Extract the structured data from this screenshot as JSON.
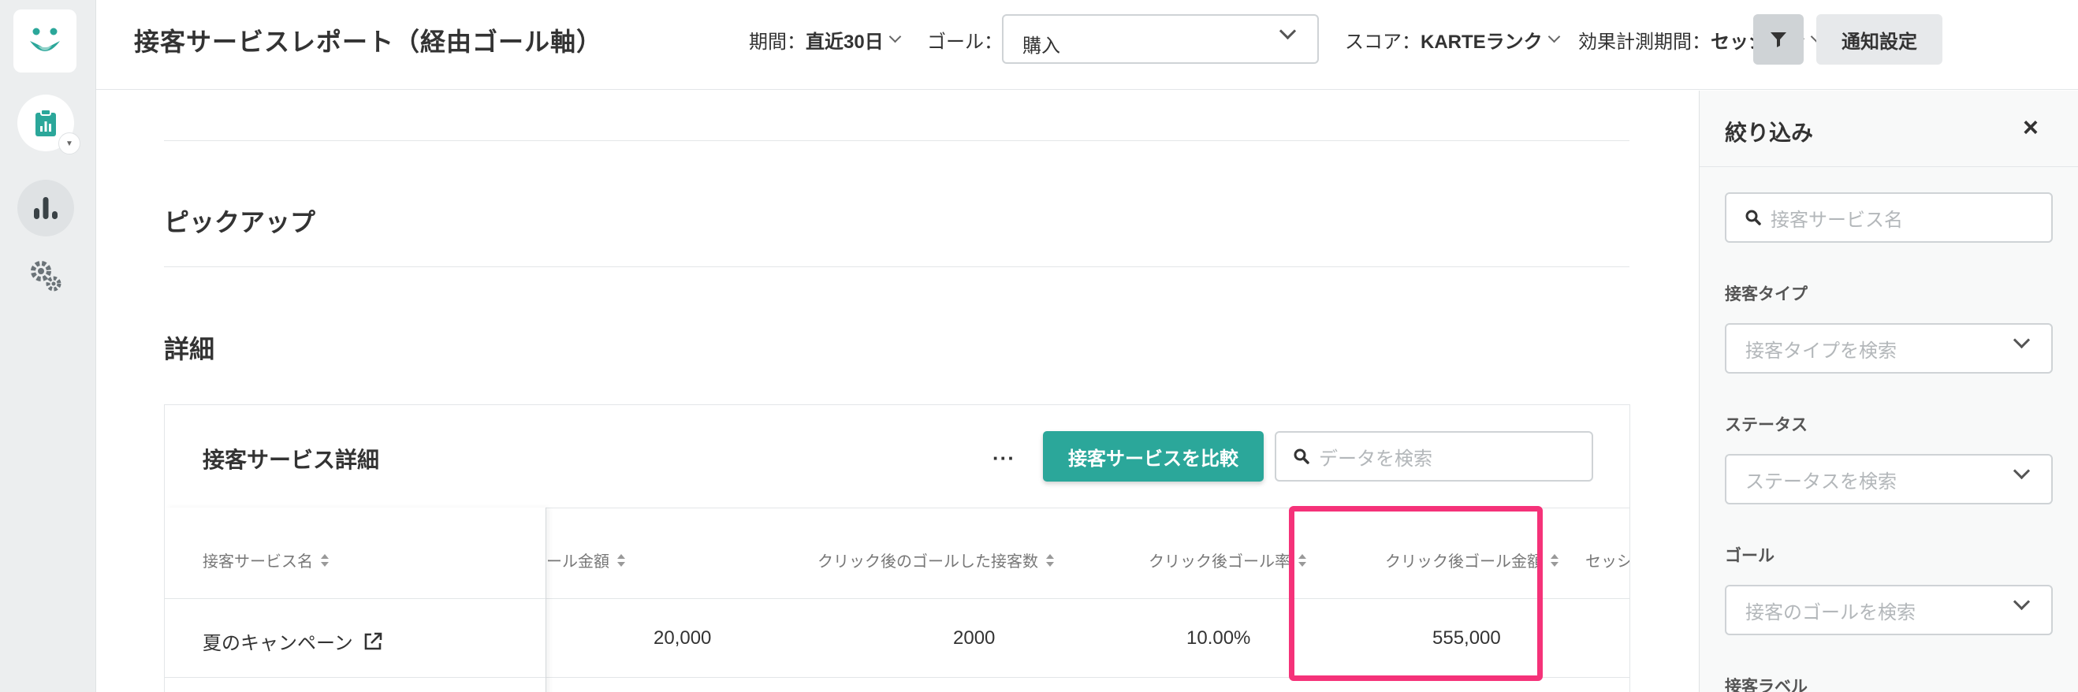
{
  "header": {
    "title": "接客サービスレポート（経由ゴール軸）",
    "period_label": "期間：",
    "period_value": "直近30日",
    "goal_label": "ゴール：",
    "goal_value": "購入",
    "score_label": "スコア：",
    "score_value": "KARTEランク",
    "measure_label": "効果計測期間：",
    "measure_value": "セッション",
    "notify_label": "通知設定"
  },
  "main": {
    "pickup_title": "ピックアップ",
    "detail_title": "詳細",
    "card": {
      "title": "接客サービス詳細",
      "more_label": "···",
      "compare_label": "接客サービスを比較",
      "search_placeholder": "データを検索",
      "columns": [
        "接客サービス名",
        "ゴール金額",
        "クリック後のゴールした接客数",
        "クリック後ゴール率",
        "クリック後ゴール金額",
        "セッシ"
      ],
      "rows": [
        {
          "name": "夏のキャンペーン",
          "goal_amount": "20,000",
          "click_goal_count": "2000",
          "click_goal_rate": "10.00%",
          "click_goal_amount": "555,000"
        }
      ]
    }
  },
  "panel": {
    "title": "絞り込み",
    "close_label": "×",
    "name_placeholder": "接客サービス名",
    "type_label": "接客タイプ",
    "type_placeholder": "接客タイプを検索",
    "status_label": "ステータス",
    "status_placeholder": "ステータスを検索",
    "goal_label": "ゴール",
    "goal_placeholder": "接客のゴールを検索",
    "tag_label": "接客ラベル"
  },
  "colors": {
    "accent": "#2ba79a",
    "highlight": "#f53279",
    "rail": "#eceeef"
  },
  "icons": [
    "karte-logo-icon",
    "report-clipboard-icon",
    "analytics-bars-icon",
    "settings-gears-icon",
    "filter-funnel-icon",
    "search-icon",
    "external-link-icon",
    "close-icon",
    "chevron-down-icon"
  ]
}
